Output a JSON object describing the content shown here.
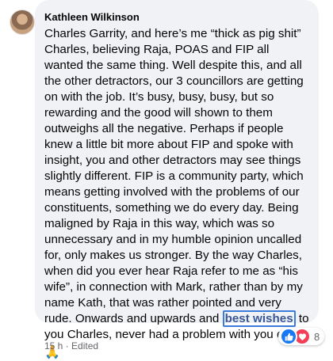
{
  "comment": {
    "author": "Kathleen Wilkinson",
    "text_before_highlight": "Charles Garrity, and here’s me “thick as pig shit” Charles, believing Raja, POAS and FIP all wanted the same thing. Well despite this, and all the other detractors, our 3 councillors are getting on with the job. It’s busy, busy, busy, but so rewarding and the good will shown to them outweighs all the negative. Perhaps if people knew a little bit more about FIP and spoke with insight, you and other detractors may see things slightly different. FIP is a community party, which means getting involved with the problems of our constituents, something we do every day. Being maligned by Raja in this way, which was so unnecessary and in my humble opinion uncalled for, only makes us stronger. By the way Charles, when did you ever hear Raja refer to me as “his wife”, in connection with Mark, rather than by my name Kath, that was rather pointed and very rude. Onwards and upwards and ",
    "highlight": "best wishes",
    "text_after_highlight": " to you Charles, never had a problem with you ever.",
    "emoji": "🙏",
    "meta": "15 h · Edited",
    "reaction_count": "8",
    "reactions": [
      "like-icon",
      "love-icon"
    ]
  },
  "colors": {
    "bubble": "#f0f2f5",
    "highlight_border": "#3b7bd9",
    "like": "#1877f2",
    "love": "#f33e58"
  }
}
